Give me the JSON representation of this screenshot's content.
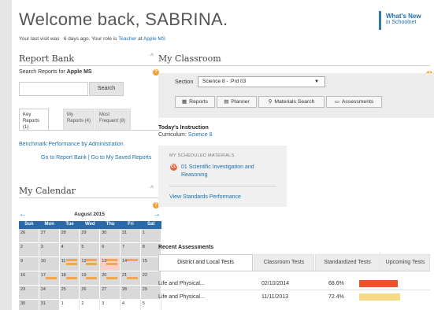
{
  "header": {
    "welcome": "Welcome back, SABRINA.",
    "last_visit_prefix": "Your last visit was",
    "last_visit_value": "6 days ago.",
    "role_prefix": "Your role is",
    "role": "Teacher",
    "at": "at",
    "school": "Apple MS",
    "whats_new_line1": "What's New",
    "whats_new_line2": "in Schoolnet"
  },
  "report_bank": {
    "title": "Report Bank",
    "search_label_prefix": "Search Reports for",
    "search_label_school": "Apple MS",
    "search_placeholder": "",
    "search_button": "Search",
    "tabs": [
      {
        "line1": "Key",
        "line2": "Reports (1)",
        "active": true
      },
      {
        "line1": "My",
        "line2": "Reports (4)",
        "active": false
      },
      {
        "line1": "Most",
        "line2": "Frequent (9)",
        "active": false
      }
    ],
    "link_benchmark": "Benchmark Performance by Administration",
    "link_goto": "Go to Report Bank | Go to My Saved Reports"
  },
  "calendar": {
    "title": "My Calendar",
    "month": "August 2015",
    "prev_icon": "←",
    "next_icon": "→",
    "days": [
      "Sun",
      "Mon",
      "Tue",
      "Wed",
      "Thu",
      "Fri",
      "Sat"
    ],
    "weeks": [
      [
        "26",
        "27",
        "28",
        "29",
        "30",
        "31",
        "1"
      ],
      [
        "2",
        "3",
        "4",
        "5",
        "6",
        "7",
        "8"
      ],
      [
        "9",
        "10",
        "11",
        "12",
        "13",
        "14",
        "15"
      ],
      [
        "16",
        "17",
        "18",
        "19",
        "20",
        "21",
        "22"
      ],
      [
        "23",
        "24",
        "25",
        "26",
        "27",
        "28",
        "29"
      ],
      [
        "30",
        "31",
        "1",
        "2",
        "3",
        "4",
        "5"
      ]
    ]
  },
  "classroom": {
    "title": "My Classroom",
    "section_label": "Section",
    "section_value": "Science 8 - :Prd 03",
    "buttons": [
      {
        "label": "Reports",
        "icon": "▦"
      },
      {
        "label": "Planner",
        "icon": "▤"
      },
      {
        "label": "Materials Search",
        "icon": "⚲"
      },
      {
        "label": "Assessments",
        "icon": "▭"
      }
    ],
    "today_title": "Today's Instruction",
    "curriculum_label": "Curriculum:",
    "curriculum_value": "Science 8",
    "scheduled_title": "MY SCHEDULED MATERIALS",
    "scheduled_item": "01 Scientific Investigation and Reasoning",
    "scheduled_icon_text": "CU",
    "standards_link": "View Standards Performance"
  },
  "assessments": {
    "title": "Recent Assessments",
    "tabs": [
      {
        "label": "District and Local Tests",
        "active": true
      },
      {
        "label": "Classroom Tests",
        "active": false
      },
      {
        "label": "Standardized Tests",
        "active": false
      },
      {
        "label": "Upcoming Tests",
        "active": false
      }
    ],
    "rows": [
      {
        "name": "Life and Physical...",
        "date": "02/10/2014",
        "score": "68.6%",
        "color": "#e8542c"
      },
      {
        "name": "Life and Physical...",
        "date": "11/11/2013",
        "score": "72.4%",
        "color": "#f7d98a"
      }
    ]
  },
  "colors": {
    "accent": "#1a70b0",
    "calendar_header": "#2a6aa8",
    "event_bar": "#f4a64a",
    "help": "#f0a030"
  }
}
